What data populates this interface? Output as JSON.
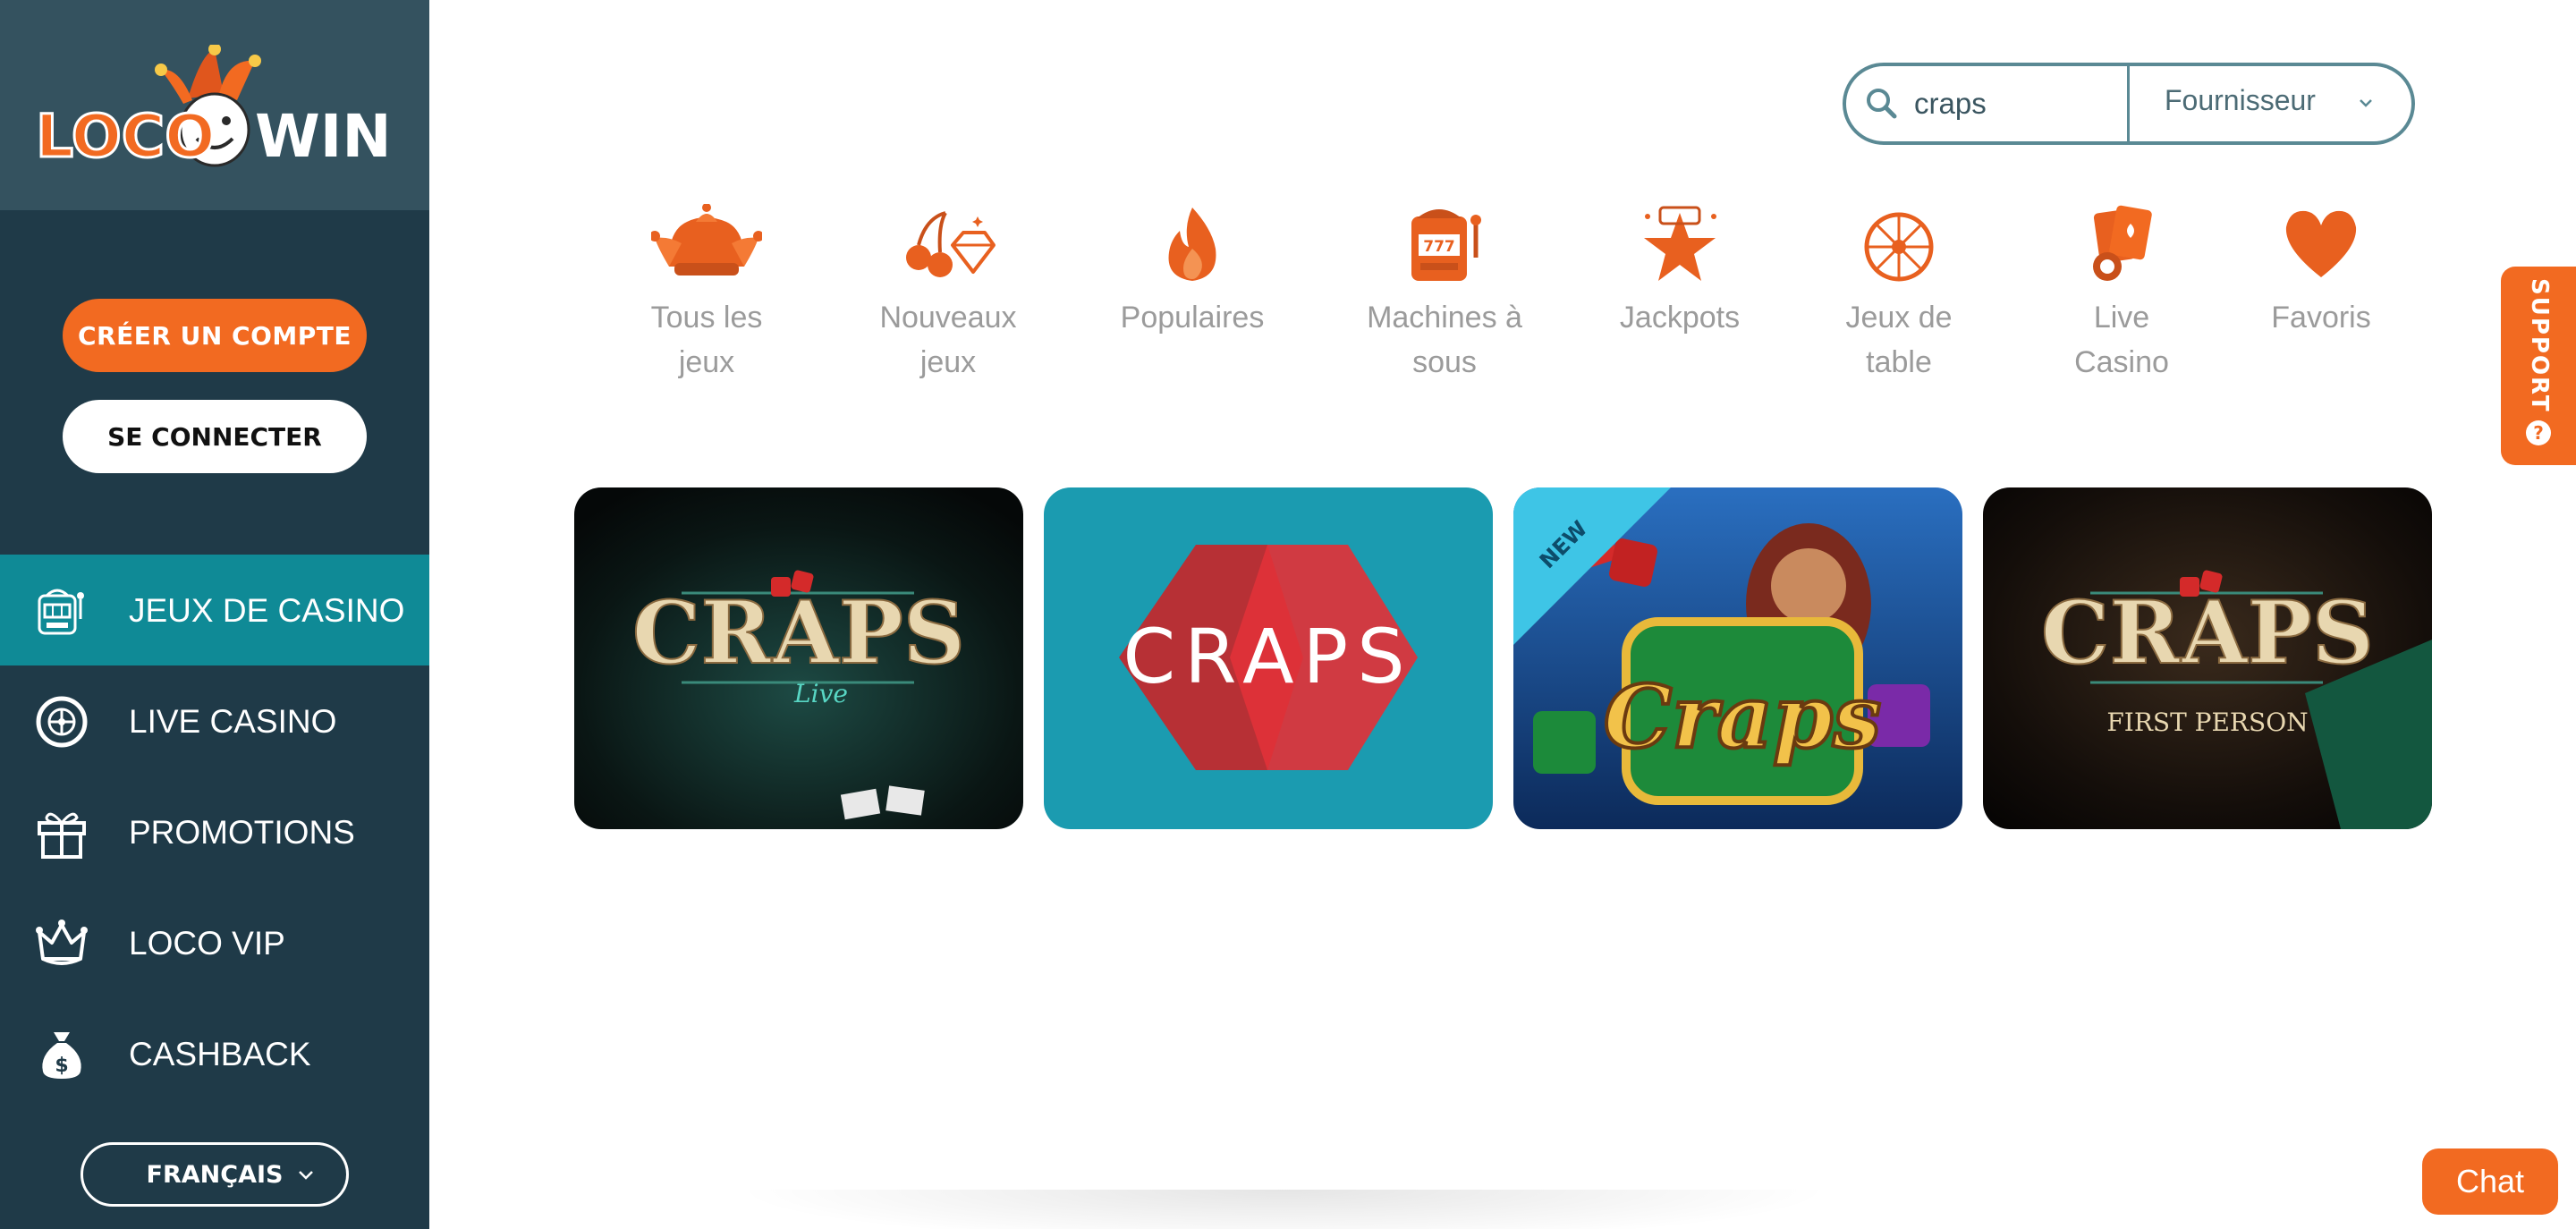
{
  "brand": {
    "logo_text_left": "LOCO",
    "logo_text_right": "WIN"
  },
  "sidebar": {
    "create_account": "CRÉER UN COMPTE",
    "login": "SE CONNECTER",
    "items": [
      {
        "label": "JEUX DE CASINO",
        "icon": "slot-machine-icon",
        "active": true
      },
      {
        "label": "LIVE CASINO",
        "icon": "roulette-wheel-icon",
        "active": false
      },
      {
        "label": "PROMOTIONS",
        "icon": "gift-icon",
        "active": false
      },
      {
        "label": "LOCO VIP",
        "icon": "jester-crown-icon",
        "active": false
      },
      {
        "label": "CASHBACK",
        "icon": "money-bag-icon",
        "active": false
      }
    ],
    "language": "FRANÇAIS"
  },
  "search": {
    "value": "craps",
    "provider": "Fournisseur"
  },
  "categories": [
    {
      "line1": "Tous les",
      "line2": "jeux",
      "icon": "jester-hat-icon"
    },
    {
      "line1": "Nouveaux",
      "line2": "jeux",
      "icon": "cherry-diamond-icon"
    },
    {
      "line1": "Populaires",
      "line2": "",
      "icon": "flame-icon"
    },
    {
      "line1": "Machines à",
      "line2": "sous",
      "icon": "slot-machine-icon"
    },
    {
      "line1": "Jackpots",
      "line2": "",
      "icon": "star-icon"
    },
    {
      "line1": "Jeux de",
      "line2": "table",
      "icon": "roulette-icon"
    },
    {
      "line1": "Live",
      "line2": "Casino",
      "icon": "cards-chip-icon"
    },
    {
      "line1": "Favoris",
      "line2": "",
      "icon": "heart-icon"
    }
  ],
  "games": [
    {
      "title": "CRAPS",
      "subtitle": "Live",
      "badge": ""
    },
    {
      "title": "CRAPS",
      "subtitle": "",
      "badge": ""
    },
    {
      "title": "Craps",
      "subtitle": "",
      "badge": "NEW"
    },
    {
      "title": "CRAPS",
      "subtitle": "FIRST PERSON",
      "badge": ""
    }
  ],
  "support": {
    "label": "SUPPORT"
  },
  "chat": {
    "label": "Chat"
  },
  "colors": {
    "accent": "#f26a21",
    "sidebar": "#1f3a48",
    "active": "#0f8a96"
  }
}
